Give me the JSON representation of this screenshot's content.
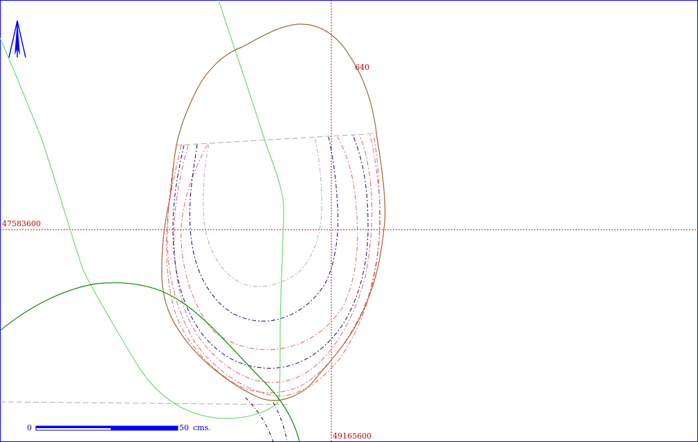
{
  "map": {
    "contour_label": "640",
    "grid_y_label": "47583600",
    "grid_x_label": "49165600",
    "scale_start": "0",
    "scale_end_label": "50",
    "scale_unit": "cms.",
    "north_arrow": "north-arrow-icon",
    "colors": {
      "frame": "#0000ff",
      "grid": "#cc0000",
      "outer_contour": "#a0622d",
      "contour_red": "#e06060",
      "contour_navy": "#000080",
      "contour_gray": "#aaaaaa",
      "light_green_line": "#66dd66",
      "dark_green_line": "#008800"
    }
  }
}
